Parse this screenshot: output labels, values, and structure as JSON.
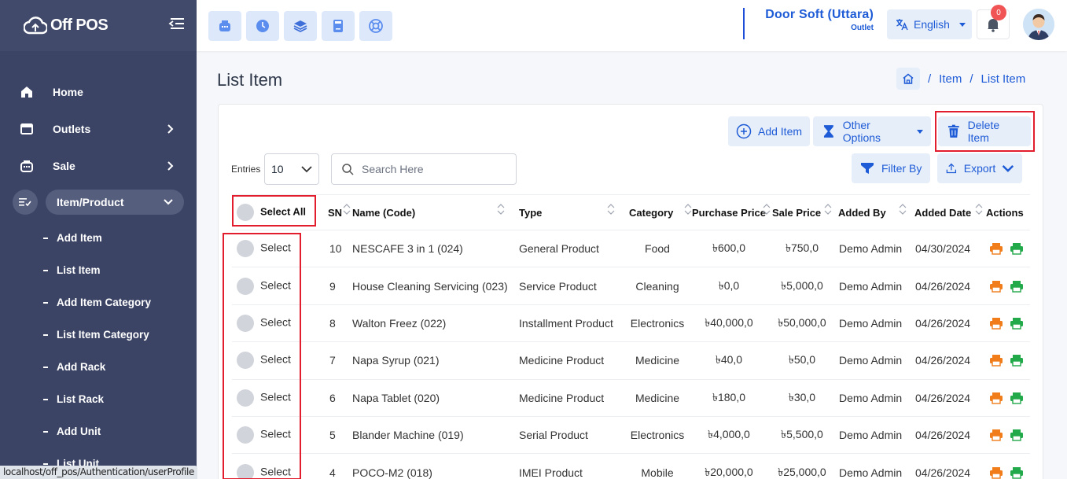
{
  "brand": {
    "name": "Off POS"
  },
  "sidebar": {
    "items": [
      {
        "label": "Home",
        "icon": "home-icon",
        "has_chevron": false
      },
      {
        "label": "Outlets",
        "icon": "store-icon",
        "has_chevron": true
      },
      {
        "label": "Sale",
        "icon": "cash-register-icon",
        "has_chevron": true
      },
      {
        "label": "Item/Product",
        "icon": "list-check-icon",
        "active": true,
        "expanded": true
      }
    ],
    "sub_items": [
      {
        "label": "Add Item"
      },
      {
        "label": "List Item"
      },
      {
        "label": "Add Item Category"
      },
      {
        "label": "List Item Category"
      },
      {
        "label": "Add Rack"
      },
      {
        "label": "List Rack"
      },
      {
        "label": "Add Unit"
      },
      {
        "label": "List Unit"
      }
    ]
  },
  "status_url": "localhost/off_pos/Authentication/userProfile",
  "header": {
    "quick_buttons": [
      "pos-icon",
      "clock-icon",
      "layers-icon",
      "calculator-icon",
      "support-icon"
    ],
    "outlet_name": "Door Soft (Uttara)",
    "outlet_sub": "Outlet",
    "language": "English",
    "notification_count": "0"
  },
  "page": {
    "title": "List Item",
    "breadcrumb": [
      "Item",
      "List Item"
    ]
  },
  "toolbar": {
    "add_item": "Add Item",
    "other_options": "Other Options",
    "delete_item": "Delete Item",
    "filter_by": "Filter By",
    "export": "Export"
  },
  "controls": {
    "entries_label": "Entries",
    "entries_value": "10",
    "search_placeholder": "Search Here"
  },
  "table": {
    "select_all": "Select All",
    "columns": [
      "SN",
      "Name (Code)",
      "Type",
      "Category",
      "Purchase Price",
      "Sale Price",
      "Added By",
      "Added Date",
      "Actions"
    ],
    "select_label": "Select",
    "rows": [
      {
        "sn": "10",
        "name": "NESCAFE 3 in 1 (024)",
        "type": "General Product",
        "category": "Food",
        "purchase": "৳600,0",
        "sale": "৳750,0",
        "added_by": "Demo Admin",
        "date": "04/30/2024"
      },
      {
        "sn": "9",
        "name": "House Cleaning Servicing (023)",
        "type": "Service Product",
        "category": "Cleaning",
        "purchase": "৳0,0",
        "sale": "৳5,000,0",
        "added_by": "Demo Admin",
        "date": "04/26/2024"
      },
      {
        "sn": "8",
        "name": "Walton Freez (022)",
        "type": "Installment Product",
        "category": "Electronics",
        "purchase": "৳40,000,0",
        "sale": "৳50,000,0",
        "added_by": "Demo Admin",
        "date": "04/26/2024"
      },
      {
        "sn": "7",
        "name": "Napa Syrup (021)",
        "type": "Medicine Product",
        "category": "Medicine",
        "purchase": "৳40,0",
        "sale": "৳50,0",
        "added_by": "Demo Admin",
        "date": "04/26/2024"
      },
      {
        "sn": "6",
        "name": "Napa Tablet (020)",
        "type": "Medicine Product",
        "category": "Medicine",
        "purchase": "৳180,0",
        "sale": "৳30,0",
        "added_by": "Demo Admin",
        "date": "04/26/2024"
      },
      {
        "sn": "5",
        "name": "Blander Machine (019)",
        "type": "Serial Product",
        "category": "Electronics",
        "purchase": "৳4,000,0",
        "sale": "৳5,500,0",
        "added_by": "Demo Admin",
        "date": "04/26/2024"
      },
      {
        "sn": "4",
        "name": "POCO-M2 (018)",
        "type": "IMEI Product",
        "category": "Mobile",
        "purchase": "৳20,000,0",
        "sale": "৳25,000,0",
        "added_by": "Demo Admin",
        "date": "04/26/2024"
      }
    ]
  },
  "colors": {
    "sidebar": "#3b4465",
    "accent": "#1e5bd6",
    "highlight": "#e11d2e",
    "edit": "#f07c1a",
    "print": "#22a94a"
  }
}
